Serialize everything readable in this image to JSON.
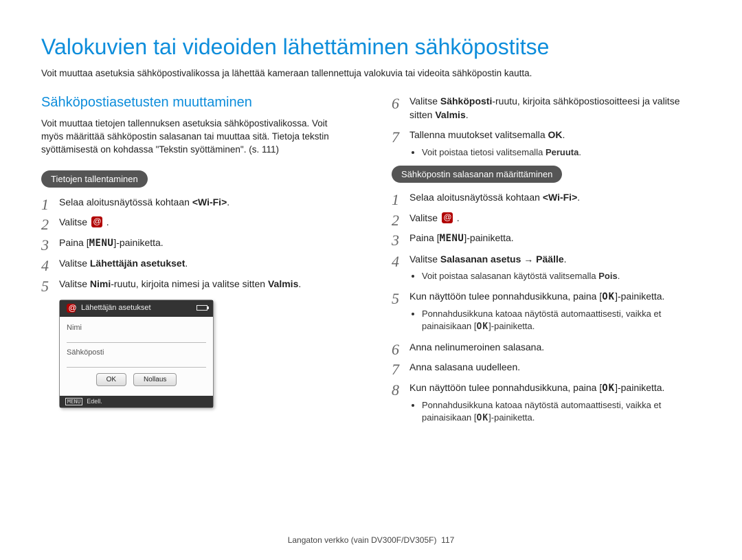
{
  "title": "Valokuvien tai videoiden lähettäminen sähköpostitse",
  "intro": "Voit muuttaa asetuksia sähköpostivalikossa ja lähettää kameraan tallennettuja valokuvia tai videoita sähköpostin kautta.",
  "left": {
    "section_title": "Sähköpostiasetusten muuttaminen",
    "section_desc": "Voit muuttaa tietojen tallennuksen asetuksia sähköpostivalikossa. Voit myös määrittää sähköpostin salasanan tai muuttaa sitä. Tietoja tekstin syöttämisestä on kohdassa \"Tekstin syöttäminen\". (s. 111)",
    "pill": "Tietojen tallentaminen",
    "steps": {
      "s1_a": "Selaa aloitusnäytössä kohtaan ",
      "s1_b": "<Wi-Fi>",
      "s1_c": ".",
      "s2": "Valitse ",
      "s2_b": " .",
      "s3_a": "Paina [",
      "s3_menu": "MENU",
      "s3_b": "]-painiketta.",
      "s4_a": "Valitse ",
      "s4_bold": "Lähettäjän asetukset",
      "s4_b": ".",
      "s5_a": "Valitse ",
      "s5_bold1": "Nimi",
      "s5_mid": "-ruutu, kirjoita nimesi ja valitse sitten ",
      "s5_bold2": "Valmis",
      "s5_b": "."
    },
    "device": {
      "header": "Lähettäjän asetukset",
      "field1": "Nimi",
      "field2": "Sähköposti",
      "btn_ok": "OK",
      "btn_reset": "Nollaus",
      "footer_menu": "MENU",
      "footer_back": "Edell."
    }
  },
  "right": {
    "steps_a": {
      "s6_a": "Valitse ",
      "s6_bold1": "Sähköposti",
      "s6_mid": "-ruutu, kirjoita sähköpostiosoitteesi ja valitse sitten ",
      "s6_bold2": "Valmis",
      "s6_b": ".",
      "s7_a": "Tallenna muutokset valitsemalla ",
      "s7_bold": "OK",
      "s7_b": ".",
      "s7_sub_a": "Voit poistaa tietosi valitsemalla ",
      "s7_sub_bold": "Peruuta",
      "s7_sub_b": "."
    },
    "pill": "Sähköpostin salasanan määrittäminen",
    "steps_b": {
      "s1_a": "Selaa aloitusnäytössä kohtaan ",
      "s1_b": "<Wi-Fi>",
      "s1_c": ".",
      "s2": "Valitse ",
      "s2_b": " .",
      "s3_a": "Paina [",
      "s3_menu": "MENU",
      "s3_b": "]-painiketta.",
      "s4_a": "Valitse ",
      "s4_bold": "Salasanan asetus",
      "s4_arrow": " → ",
      "s4_bold2": "Päälle",
      "s4_b": ".",
      "s4_sub_a": "Voit poistaa salasanan käytöstä valitsemalla ",
      "s4_sub_bold": "Pois",
      "s4_sub_b": ".",
      "s5_a": "Kun näyttöön tulee ponnahdusikkuna, paina [",
      "s5_ok": "OK",
      "s5_b": "]-painiketta.",
      "s5_sub_a": "Ponnahdusikkuna katoaa näytöstä automaattisesti, vaikka et painaisikaan [",
      "s5_sub_ok": "OK",
      "s5_sub_b": "]-painiketta.",
      "s6": "Anna nelinumeroinen salasana.",
      "s7": "Anna salasana uudelleen.",
      "s8_a": "Kun näyttöön tulee ponnahdusikkuna, paina [",
      "s8_ok": "OK",
      "s8_b": "]-painiketta.",
      "s8_sub_a": "Ponnahdusikkuna katoaa näytöstä automaattisesti, vaikka et painaisikaan [",
      "s8_sub_ok": "OK",
      "s8_sub_b": "]-painiketta."
    }
  },
  "footer": {
    "text": "Langaton verkko (vain DV300F/DV305F)",
    "page": "117"
  }
}
